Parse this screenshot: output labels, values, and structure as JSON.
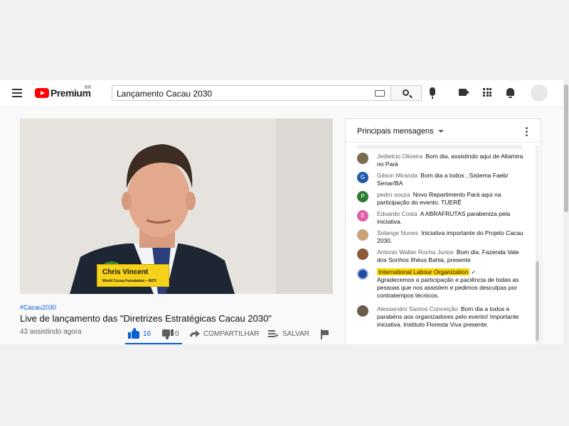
{
  "header": {
    "brand": "Premium",
    "region": "BR",
    "search_query": "Lançamento Cacau 2030"
  },
  "video": {
    "lower_third_name": "Chris Vincent",
    "lower_third_org": "World Cocoa Foundation – WCF",
    "hashtag": "#Cacau2030",
    "title": "Live de lançamento das \"Diretrizes Estratégicas Cacau 2030\"",
    "viewers": "43 assistindo agora",
    "likes": "16",
    "dislikes": "0",
    "share_label": "COMPARTILHAR",
    "save_label": "SALVAR"
  },
  "chat": {
    "title": "Principais mensagens",
    "messages": [
      {
        "author": "Jedielcio Oliveira",
        "text": "Bom dia, assistindo aqui de Altamira no Pará",
        "avatar": "",
        "color": "#7a6a52"
      },
      {
        "author": "Gilson Miranda",
        "text": "Bom dia a todos , Sistema Faeb/ Senar/BA",
        "avatar": "G",
        "color": "#1e5aa8"
      },
      {
        "author": "pedro souza",
        "text": "Novo Repartimento Pará aqui na participação do evento. TUERÊ",
        "avatar": "P",
        "color": "#2e7d32"
      },
      {
        "author": "Eduardo Costa",
        "text": "A ABRAFRUTAS parabeniza pela iniciativa.",
        "avatar": "E",
        "color": "#e15fa8"
      },
      {
        "author": "Solange Nunes",
        "text": "Iniciativa importante do Projeto Cacau 2030.",
        "avatar": "",
        "color": "#c9a27a"
      },
      {
        "author": "Antonio Walter Rocha Junior",
        "text": "Bom dia. Fazenda Vale dos Sonhos Ilhéus Bahia, presente",
        "avatar": "",
        "color": "#8a5a3a"
      },
      {
        "author": "International Labour Organization",
        "text": "Agradecemos a participação e paciência de todas as pessoas que nos assistem e pedimos desculpas por contratempos técnicos.",
        "avatar": "",
        "color": "#1f4aa0",
        "owner": true
      },
      {
        "author": "Alessandro Santos Conceição",
        "text": "Bom dia a todos e parabéns aos organizadores pelo evento! Importante iniciativa. Instituto Floresta Viva presente.",
        "avatar": "",
        "color": "#6b5b4b"
      }
    ]
  }
}
